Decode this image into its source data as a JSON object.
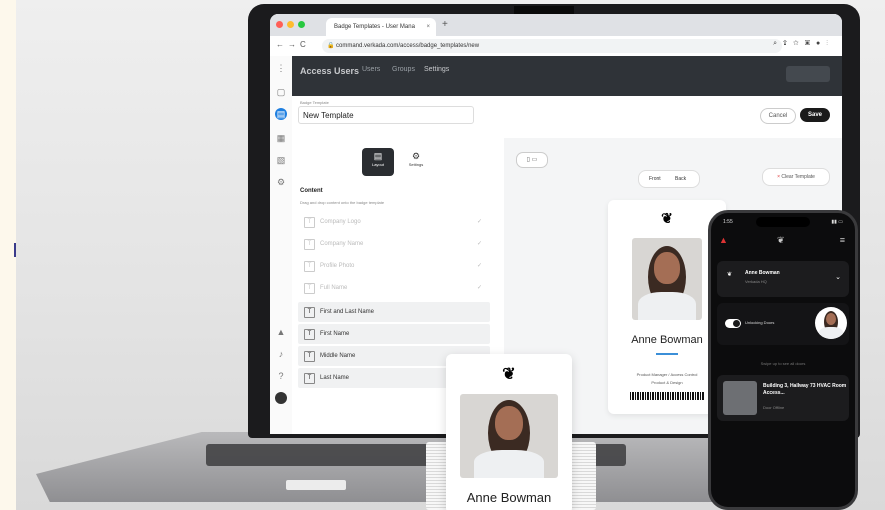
{
  "browser": {
    "tab_title": "Badge Templates - User Mana",
    "tab_close": "×",
    "new_tab": "+",
    "url": "command.verkada.com/access/badge_templates/new"
  },
  "topnav": {
    "title": "Access Users",
    "tabs": [
      "Users",
      "Groups",
      "Settings"
    ]
  },
  "editor": {
    "template_label": "Badge Template",
    "template_name": "New Template",
    "cancel_label": "Cancel",
    "save_label": "Save",
    "mode_tabs": [
      {
        "label": "Layout",
        "icon": "layout-icon",
        "selected": true
      },
      {
        "label": "Settings",
        "icon": "gear-icon",
        "selected": false
      }
    ],
    "content_heading": "Content",
    "content_hint": "Drag and drop content onto the badge template",
    "fields": [
      {
        "label": "Company Logo",
        "added": true
      },
      {
        "label": "Company Name",
        "added": true
      },
      {
        "label": "Profile Photo",
        "added": true
      },
      {
        "label": "Full Name",
        "added": true
      },
      {
        "label": "First and Last Name",
        "added": false
      },
      {
        "label": "First Name",
        "added": false
      },
      {
        "label": "Middle Name",
        "added": false
      },
      {
        "label": "Last Name",
        "added": false
      }
    ],
    "field_icon_glyph": "T",
    "check_glyph": "✓"
  },
  "preview": {
    "front_label": "Front",
    "back_label": "Back",
    "clear_label": "Clear Template",
    "card_name": "Anne Bowman",
    "card_role": "Product Manager / Access Control",
    "card_dept": "Product & Design"
  },
  "physical_badge": {
    "name": "Anne Bowman"
  },
  "phone": {
    "time": "1:55",
    "user_name": "Anne Bowman",
    "user_org": "Verkada HQ",
    "unlock_label": "Unlocking Doors",
    "swipe_hint": "Swipe up to see all doors",
    "door_title": "Building 3, Hallway 73 HVAC Room Access...",
    "door_status": "Door Offline"
  },
  "colors": {
    "accent_blue": "#1f7fe0",
    "dark_nav": "#2f3338",
    "badge_accent": "#3b8fd8"
  }
}
